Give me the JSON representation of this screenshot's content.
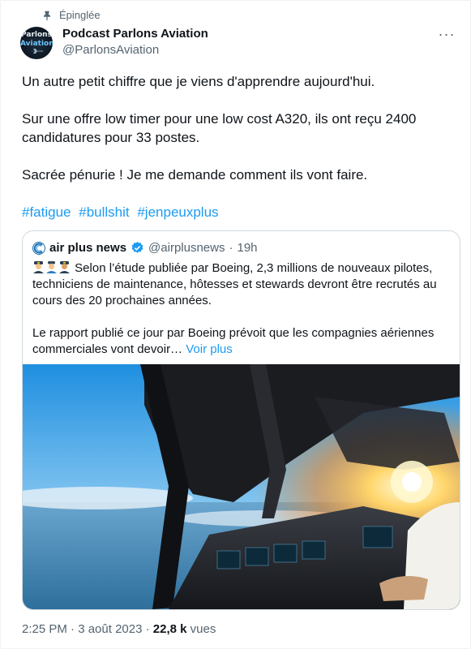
{
  "pinned_label": "Épinglée",
  "author": {
    "name": "Podcast Parlons Aviation",
    "handle": "@ParlonsAviation",
    "avatar_line1": "Parlons",
    "avatar_line2": "Aviation"
  },
  "more_label": "···",
  "tweet": {
    "para1": "Un autre petit chiffre que je viens d'apprendre aujourd'hui.",
    "para2": "Sur une offre low timer pour une low cost A320, ils ont reçu 2400 candidatures pour 33 postes.",
    "para3": "Sacrée pénurie ! Je me demande comment ils vont faire.",
    "hashtags": [
      "#fatigue",
      "#bullshit",
      "#jenpeuxplus"
    ]
  },
  "quote": {
    "name": "air plus news",
    "handle": "@airplusnews",
    "dot": "·",
    "time": "19h",
    "text1": "Selon l’étude publiée par Boeing, 2,3 millions de nouveaux pilotes, techniciens de maintenance, hôtesses et stewards devront être recrutés au cours des 20 prochaines années.",
    "text2": "Le rapport publié ce jour par Boeing prévoit que les compagnies aériennes commerciales vont devoir… ",
    "see_more": "Voir plus",
    "emojis": [
      "pilot-emoji",
      "flight-attendant-emoji",
      "pilot-emoji"
    ]
  },
  "meta": {
    "time_date": "2:25 PM · 3 août 2023 · ",
    "views_count": "22,8 k",
    "views_label": " vues"
  },
  "colors": {
    "link": "#1d9bf0",
    "secondary_text": "#536471",
    "primary_text": "#0f1419",
    "border": "#cfd9de"
  }
}
